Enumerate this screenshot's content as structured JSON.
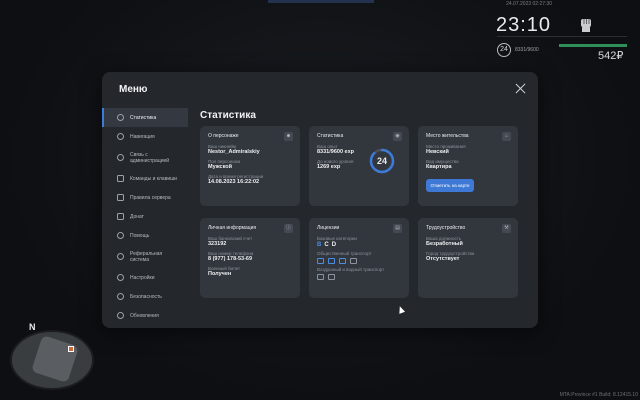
{
  "hud": {
    "datetime": "24.07.2023 02:27:30",
    "clock": "23:10",
    "level": "24",
    "exp": "8331/9600",
    "money": "542₽",
    "version": "MTA:Province #1 Build: 8.12415.10"
  },
  "minimap": {
    "north_label": "N"
  },
  "modal": {
    "title": "Меню",
    "content_title": "Статистика"
  },
  "sidebar": {
    "items": [
      {
        "label": "Статистика",
        "icon": "chart-icon"
      },
      {
        "label": "Навигация",
        "icon": "compass-icon"
      },
      {
        "label": "Связь с администрацией",
        "icon": "headset-icon"
      },
      {
        "label": "Команды и клавиши",
        "icon": "keyboard-icon"
      },
      {
        "label": "Правила сервера",
        "icon": "rules-icon"
      },
      {
        "label": "Донат",
        "icon": "donate-icon"
      },
      {
        "label": "Помощь",
        "icon": "help-icon"
      },
      {
        "label": "Реферальная система",
        "icon": "referral-icon"
      },
      {
        "label": "Настройки",
        "icon": "gear-icon"
      },
      {
        "label": "Безопасность",
        "icon": "shield-icon"
      },
      {
        "label": "Обновления",
        "icon": "refresh-icon"
      }
    ]
  },
  "cards": {
    "about": {
      "title": "О персонаже",
      "nick_label": "Ваш никнейм",
      "nick": "Nestor_Admiralskiy",
      "sex_label": "Пол персонажа",
      "sex": "Мужской",
      "reg_label": "Дата и время регистрации",
      "reg": "14.08.2023 16:22:02"
    },
    "stats": {
      "title": "Статистика",
      "exp_label": "Ваш опыт",
      "exp": "8331/9600 exp",
      "next_label": "До нового уровня",
      "next": "1269 exp",
      "level": "24",
      "progress": 0.868
    },
    "residence": {
      "title": "Место жительства",
      "place_label": "Место проживания",
      "place": "Невский",
      "type_label": "Вид имущества",
      "type": "Квартира",
      "button": "Отметить на карте"
    },
    "personal": {
      "title": "Личная информация",
      "bank_label": "Ваш банковский счет",
      "bank": "323192",
      "phone_label": "Ваш номер телефона",
      "phone": "8 (977) 178-53-69",
      "military_label": "Военный билет",
      "military": "Получен"
    },
    "licenses": {
      "title": "Лицензии",
      "base_label": "Базовые категории",
      "cat_b": "B",
      "cat_c": "C",
      "cat_d": "D",
      "public_label": "Общественный транспорт",
      "air_label": "Воздушный и водный транспорт"
    },
    "employment": {
      "title": "Трудоустройство",
      "job_label": "Ваша должность",
      "job": "Безработный",
      "city_label": "Город трудоустройства",
      "city": "Отсутствует"
    }
  }
}
